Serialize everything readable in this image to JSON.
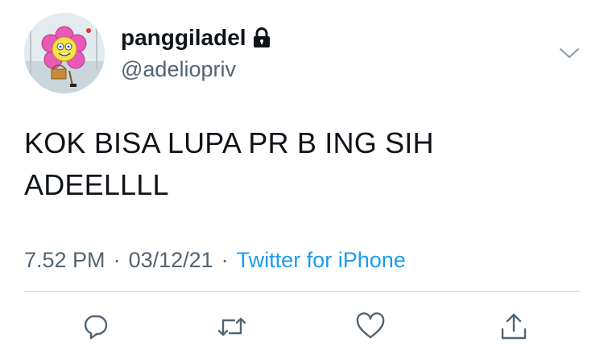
{
  "user": {
    "display_name": "panggiladel",
    "handle": "@adeliopriv",
    "protected_icon": "lock-icon",
    "avatar_icon": "cartoon-flower-avatar"
  },
  "tweet": {
    "text": "KOK BISA LUPA PR B ING SIH\nADEELLLL",
    "time": "7.52 PM",
    "date": "03/12/21",
    "separator": "·",
    "source": "Twitter for iPhone"
  },
  "actions": [
    {
      "icon": "reply-icon"
    },
    {
      "icon": "retweet-icon"
    },
    {
      "icon": "like-icon"
    },
    {
      "icon": "share-icon"
    }
  ],
  "colors": {
    "text": "#0f1419",
    "secondary": "#536471",
    "link": "#1d9bf0",
    "divider": "#cfd9de"
  }
}
